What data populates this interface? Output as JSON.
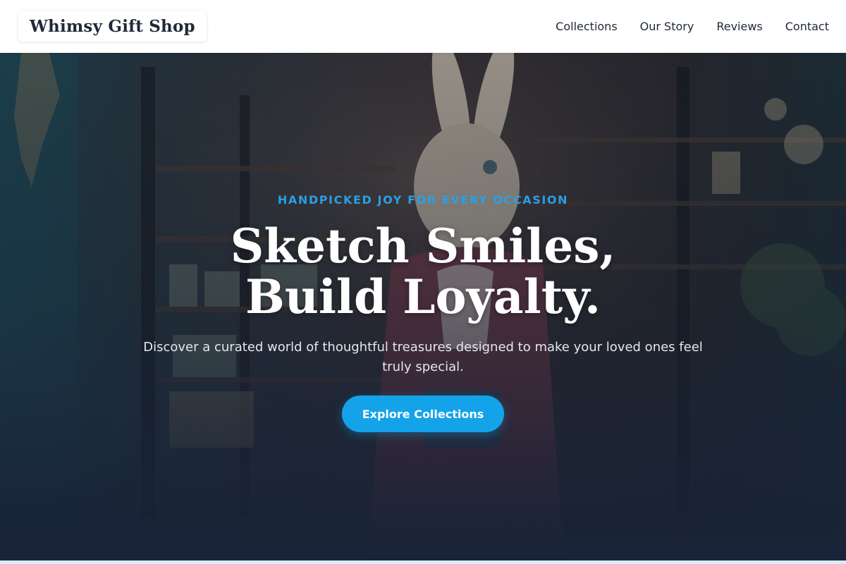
{
  "header": {
    "logo": "Whimsy Gift Shop",
    "nav": [
      "Collections",
      "Our Story",
      "Reviews",
      "Contact"
    ]
  },
  "hero": {
    "eyebrow": "HANDPICKED JOY FOR EVERY OCCASION",
    "headline": "Sketch Smiles, Build Loyalty.",
    "subtext": "Discover a curated world of thoughtful treasures designed to make your loved ones feel truly special.",
    "cta_label": "Explore Collections",
    "background_image": "gift-shop-rabbit-figure-photo"
  },
  "colors": {
    "accent": "#14a3e9",
    "eyebrow": "#2b9fe6",
    "header_bg": "#ffffff",
    "hero_dark": "#1c2535"
  }
}
